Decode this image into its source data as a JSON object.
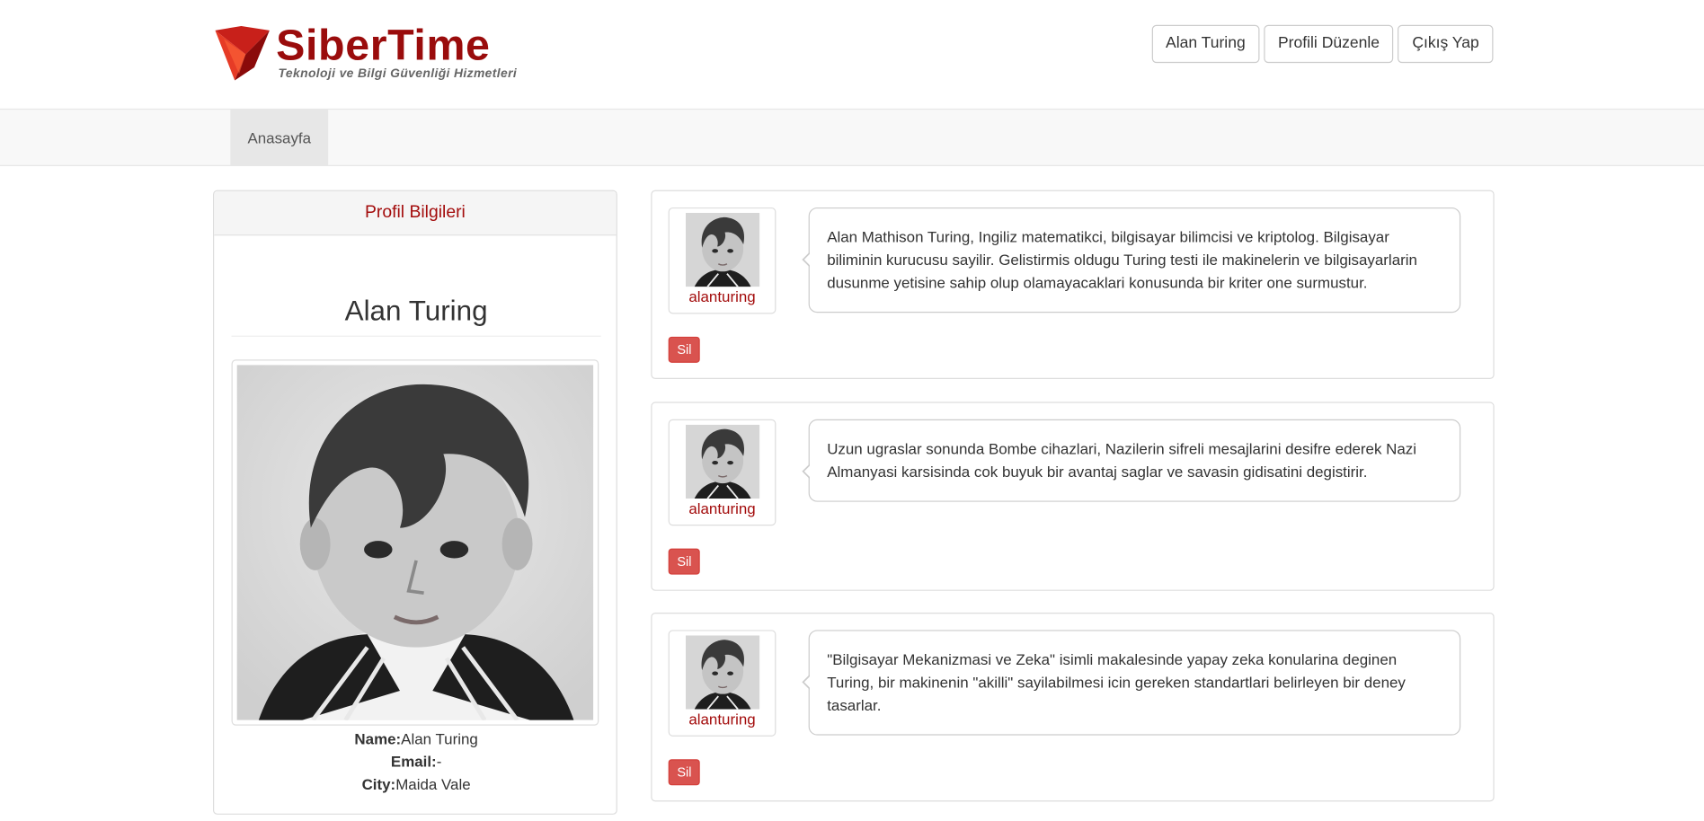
{
  "header": {
    "logo_title": "SiberTime",
    "logo_subtitle": "Teknoloji ve Bilgi Güvenliği Hizmetleri",
    "buttons": [
      "Alan Turing",
      "Profili Düzenle",
      "Çıkış Yap"
    ]
  },
  "nav": {
    "items": [
      "Anasayfa"
    ]
  },
  "profile": {
    "panel_title": "Profil Bilgileri",
    "name": "Alan Turing",
    "name_label": "Name:",
    "name_value": "Alan Turing",
    "email_label": "Email:",
    "email_value": "-",
    "city_label": "City:",
    "city_value": "Maida Vale"
  },
  "posts": [
    {
      "username": "alanturing",
      "text": "Alan Mathison Turing, Ingiliz matematikci, bilgisayar bilimcisi ve kriptolog. Bilgisayar biliminin kurucusu sayilir. Gelistirmis oldugu Turing testi ile makinelerin ve bilgisayarlarin dusunme yetisine sahip olup olamayacaklari konusunda bir kriter one surmustur.",
      "delete_label": "Sil"
    },
    {
      "username": "alanturing",
      "text": "Uzun ugraslar sonunda Bombe cihazlari, Nazilerin sifreli mesajlarini desifre ederek Nazi Almanyasi karsisinda cok buyuk bir avantaj saglar ve savasin gidisatini degistirir.",
      "delete_label": "Sil"
    },
    {
      "username": "alanturing",
      "text": "\"Bilgisayar Mekanizmasi ve Zeka\" isimli makalesinde yapay zeka konularina deginen Turing, bir makinenin \"akilli\" sayilabilmesi icin gereken standartlari belirleyen bir deney tasarlar.",
      "delete_label": "Sil"
    }
  ],
  "colors": {
    "brand": "#9a0c0c",
    "danger": "#d9534f"
  }
}
